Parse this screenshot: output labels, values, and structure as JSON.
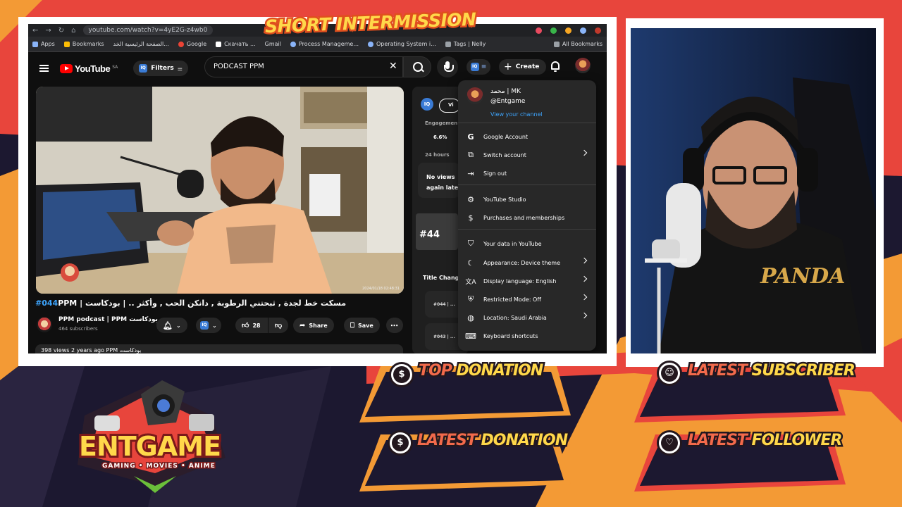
{
  "overlay": {
    "banner": "SHORT INTERMISSION",
    "panels": [
      {
        "word1": "TOP",
        "word2": "DONATION",
        "icon": "dollar-icon"
      },
      {
        "word1": "LATEST",
        "word2": "SUBSCRIBER",
        "icon": "user-icon"
      },
      {
        "word1": "LATEST",
        "word2": "DONATION",
        "icon": "dollar-icon"
      },
      {
        "word1": "LATEST",
        "word2": "FOLLOWER",
        "icon": "heart-icon"
      }
    ],
    "logo": {
      "name": "ENTGAME",
      "tagline": "GAMING • MOVIES • ANIME"
    },
    "colors": {
      "accent_red": "#e8453c",
      "accent_orange": "#f39a35",
      "accent_yellow": "#ffd84a",
      "dark": "#1c1830"
    }
  },
  "browser": {
    "url": "youtube.com/watch?v=4yE2G-z4wb0",
    "bookmarks": [
      "Apps",
      "Bookmarks",
      "الصفحة الرئيسية الخد...",
      "Google",
      "Скачать ...",
      "Gmail",
      "Process Manageme...",
      "Operating System i...",
      "Tags | Nelly"
    ],
    "all_bookmarks": "All Bookmarks"
  },
  "youtube": {
    "logo": "YouTube",
    "region": "SA",
    "filters_label": "Filters",
    "search_value": "PODCAST PPM",
    "create_label": "Create",
    "video": {
      "title_hash": "#044",
      "title_rest": "PPM | مسكت خط لجدة , ثبحتني الرطوبة , دانكن الحب , وأكثر .. | بودكاست",
      "timestamp": "2024/01/18 02:48:31",
      "channel": "PPM podcast | PPM بودكاست",
      "subscribers": "464 subscribers",
      "likes": "28",
      "share": "Share",
      "save": "Save",
      "meta": "398 views  2 years ago  PPM بودكاست"
    },
    "side": {
      "engagement": "Engagemen",
      "engagement_value": "6.6%",
      "period": "24 hours",
      "no_views_1": "No views",
      "no_views_2": "again late",
      "thumb_label": "#44",
      "title_changes": "Title Chang",
      "item1": "#044 | ...",
      "item2": "#043 | ..."
    },
    "menu": {
      "name": "محمد | MK",
      "handle": "@Entgame",
      "view_channel": "View your channel",
      "items": [
        {
          "label": "Google Account",
          "icon": "google-icon",
          "chevron": false
        },
        {
          "label": "Switch account",
          "icon": "switch-account-icon",
          "chevron": true
        },
        {
          "label": "Sign out",
          "icon": "sign-out-icon",
          "chevron": false
        },
        {
          "label": "YouTube Studio",
          "icon": "studio-icon",
          "chevron": false
        },
        {
          "label": "Purchases and memberships",
          "icon": "dollar-icon",
          "chevron": false
        },
        {
          "label": "Your data in YouTube",
          "icon": "shield-user-icon",
          "chevron": false
        },
        {
          "label": "Appearance: Device theme",
          "icon": "moon-icon",
          "chevron": true
        },
        {
          "label": "Display language: English",
          "icon": "translate-icon",
          "chevron": true
        },
        {
          "label": "Restricted Mode: Off",
          "icon": "lock-icon",
          "chevron": true
        },
        {
          "label": "Location: Saudi Arabia",
          "icon": "globe-icon",
          "chevron": true
        },
        {
          "label": "Keyboard shortcuts",
          "icon": "keyboard-icon",
          "chevron": false
        }
      ]
    }
  },
  "webcam": {
    "shirt_text": "PANDA"
  }
}
